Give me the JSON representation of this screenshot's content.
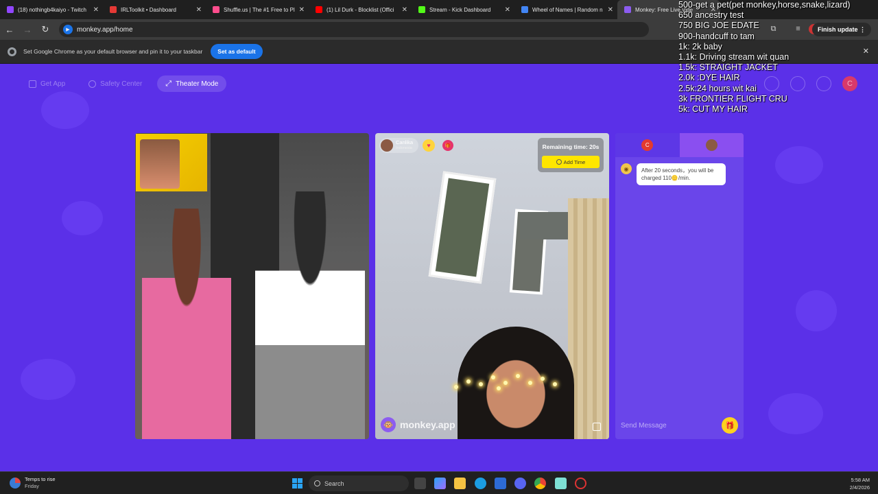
{
  "tabs": [
    {
      "title": "(18) nothingb4kaiyo - Twitch",
      "color": "#9146ff"
    },
    {
      "title": "IRLToolkit • Dashboard",
      "color": "#e53935"
    },
    {
      "title": "Shuffle.us | The #1 Free to Pl",
      "color": "#ff4d8d"
    },
    {
      "title": "(1) Lil Durk - Blocklist (Offici",
      "color": "#ff0000"
    },
    {
      "title": "Stream - Kick Dashboard",
      "color": "#53fc18"
    },
    {
      "title": "Wheel of Names | Random n",
      "color": "#4285f4"
    },
    {
      "title": "Monkey: Free Live Vide",
      "color": "#8c5cf0"
    }
  ],
  "toolbar": {
    "url": "monkey.app/home",
    "gemini_label": "Gemini",
    "finish_update": "Finish update"
  },
  "infobar": {
    "message": "Set Google Chrome as your default browser and pin it to your taskbar",
    "button": "Set as default"
  },
  "app": {
    "nav": {
      "get_app": "Get App",
      "safety_center": "Safety Center",
      "theater_mode": "Theater Mode"
    },
    "profile_initial": "C",
    "remote_user": {
      "name": "Canlika",
      "country": "Indonesia"
    },
    "timer": {
      "remaining": "Remaining time: 20s",
      "add_time": "Add Time"
    },
    "watermark": "monkey.app",
    "chat": {
      "tab_initial": "C",
      "system_message": "After 20 seconds，you will be charged 110🪙/min.",
      "send_placeholder": "Send Message"
    }
  },
  "overlay_goals": [
    "500-get a pet(pet monkey,horse,snake,lizard)",
    "650 ancestry test",
    "750 BIG JOE EDATE",
    "900-handcuff to tam",
    "1k: 2k baby",
    "1.1k: Driving stream wit quan",
    "1.5k: STRAIGHT JACKET",
    "2.0k :DYE HAIR",
    "2.5k:24 hours wit kai",
    "3k FRONTIER FLIGHT CRU",
    "5k: CUT MY HAIR"
  ],
  "taskbar": {
    "weather_title": "Temps to rise",
    "weather_sub": "Friday",
    "search": "Search",
    "time": "5:58 AM",
    "date": "2/4/2026"
  }
}
